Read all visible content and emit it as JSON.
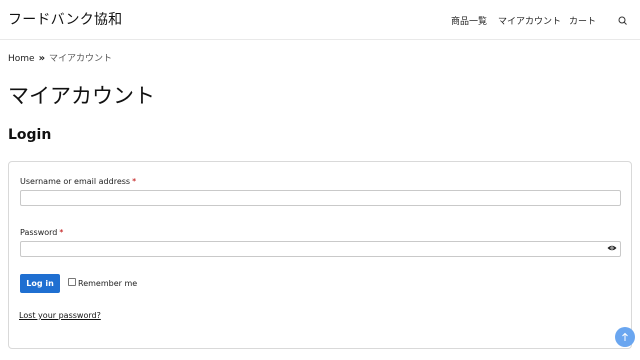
{
  "header": {
    "site_title": "フードバンク協和",
    "nav": [
      {
        "label": "商品一覧"
      },
      {
        "label": "マイアカウント"
      },
      {
        "label": "カート"
      }
    ],
    "search_icon": "search-icon"
  },
  "breadcrumb": {
    "home": "Home",
    "separator": "»",
    "current": "マイアカウント"
  },
  "page_title": "マイアカウント",
  "login": {
    "heading": "Login",
    "username_label": "Username or email address",
    "password_label": "Password",
    "required_mark": "*",
    "username_value": "",
    "password_value": "",
    "show_password_icon": "eye-icon",
    "submit_label": "Log in",
    "remember_label": "Remember me",
    "remember_checked": false,
    "lost_password": "Lost your password?"
  },
  "scroll_top_icon": "arrow-up-icon",
  "colors": {
    "accent": "#1f6fd1",
    "scroll_top": "#6aa6f0",
    "required": "#bb0000"
  }
}
